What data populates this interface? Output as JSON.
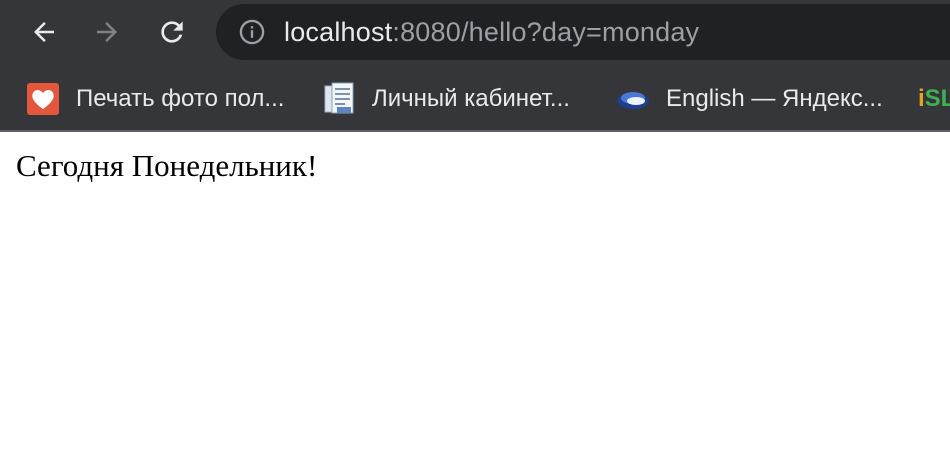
{
  "toolbar": {
    "back_icon": "arrow-left-icon",
    "forward_icon": "arrow-right-icon",
    "reload_icon": "reload-icon",
    "forward_enabled": false
  },
  "address_bar": {
    "info_icon": "info-icon",
    "host": "localhost",
    "rest": ":8080/hello?day=monday"
  },
  "bookmarks": [
    {
      "icon": "heart-icon",
      "label": "Печать фото пол..."
    },
    {
      "icon": "document-icon",
      "label": "Личный кабинет..."
    },
    {
      "icon": "yandex-disk-icon",
      "label": "English — Яндекс..."
    },
    {
      "icon": "islate-logo",
      "label": "iSL"
    }
  ],
  "page": {
    "message": "Сегодня Понедельник!"
  },
  "colors": {
    "toolbar_bg": "#35363a",
    "omnibox_bg": "#202124",
    "text_primary": "#e8eaed",
    "text_secondary": "#9aa0a6",
    "page_bg": "#ffffff"
  }
}
